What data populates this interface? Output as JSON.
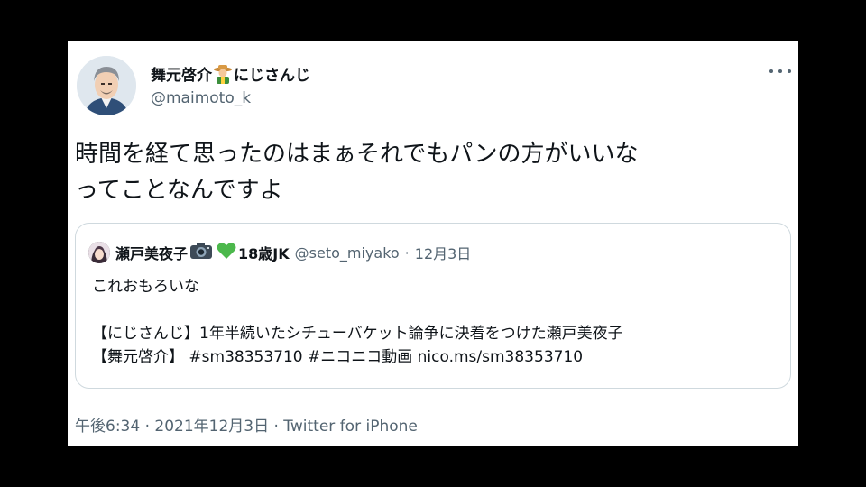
{
  "tweet": {
    "author": {
      "display_name": "舞元啓介",
      "display_name_suffix": "にじさんじ",
      "name_emoji": "farmer-emoji",
      "handle": "@maimoto_k",
      "avatar": "avatar-illustration"
    },
    "more_icon": "more-horizontal-icon",
    "text_lines": [
      "時間を経て思ったのはまぁそれでもパンの方がいいな",
      "ってことなんですよ"
    ],
    "quoted": {
      "display_name": "瀬戸美夜子",
      "name_emojis": [
        "camera-emoji",
        "green-heart-emoji"
      ],
      "name_suffix": "18歳JK",
      "handle": "@seto_miyako",
      "separator": "·",
      "date": "12月3日",
      "lines": [
        "これおもろいな",
        "",
        "【にじさんじ】1年半続いたシチューバケット論争に決着をつけた瀬戸美夜子",
        "【舞元啓介】 #sm38353710 #ニコニコ動画 nico.ms/sm38353710"
      ]
    },
    "footer": "午後6:34 · 2021年12月3日 · Twitter for iPhone"
  },
  "colors": {
    "background": "#000000",
    "card": "#ffffff",
    "text_primary": "#0f1419",
    "text_secondary": "#536471",
    "border": "#cfd9de"
  }
}
